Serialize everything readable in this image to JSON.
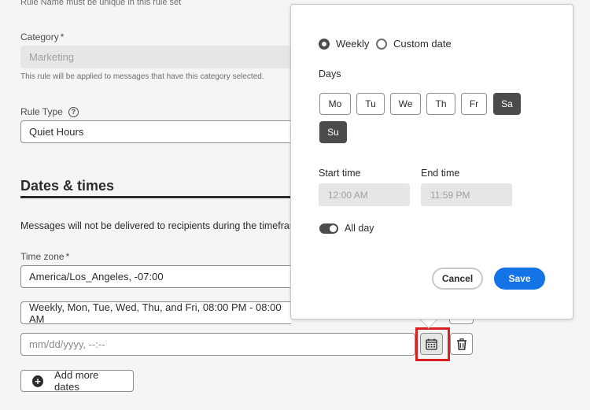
{
  "form": {
    "rule_name_helper": "Rule Name must be unique in this rule set",
    "category_label": "Category",
    "required_mark": "*",
    "category_value": "Marketing",
    "category_helper": "This rule will be applied to messages that have this category selected.",
    "rule_type_label": "Rule Type",
    "rule_type_help": "?",
    "rule_type_value": "Quiet Hours",
    "dates_heading": "Dates & times",
    "dates_description": "Messages will not be delivered to recipients during the timeframes s",
    "timezone_label": "Time zone",
    "timezone_value": "America/Los_Angeles, -07:00",
    "schedule_value": "Weekly, Mon, Tue, Wed, Thu, and Fri, 08:00 PM - 08:00 AM",
    "date_placeholder": "mm/dd/yyyy, --:--",
    "add_more_label": "Add more dates"
  },
  "popover": {
    "weekly_label": "Weekly",
    "custom_label": "Custom date",
    "days_label": "Days",
    "days": [
      {
        "label": "Mo",
        "selected": false
      },
      {
        "label": "Tu",
        "selected": false
      },
      {
        "label": "We",
        "selected": false
      },
      {
        "label": "Th",
        "selected": false
      },
      {
        "label": "Fr",
        "selected": false
      },
      {
        "label": "Sa",
        "selected": true
      },
      {
        "label": "Su",
        "selected": true
      }
    ],
    "start_label": "Start time",
    "start_value": "12:00 AM",
    "end_label": "End time",
    "end_value": "11:59 PM",
    "all_day_label": "All day",
    "all_day_on": true,
    "cancel_label": "Cancel",
    "save_label": "Save"
  },
  "colors": {
    "accent": "#1473e6",
    "highlight": "#d7201f",
    "selected_day": "#4b4b4b"
  }
}
